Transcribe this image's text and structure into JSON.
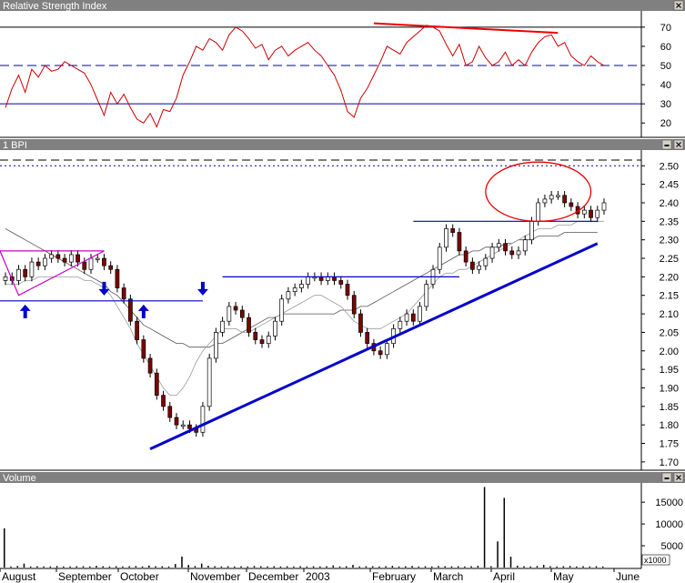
{
  "panels": {
    "rsi": {
      "title": "Relative Strength Index",
      "y_ticks": [
        "70",
        "60",
        "50",
        "40",
        "30",
        "20"
      ]
    },
    "price": {
      "title": "1 BPI",
      "y_ticks": [
        "2.50",
        "2.45",
        "2.40",
        "2.35",
        "2.30",
        "2.25",
        "2.20",
        "2.15",
        "2.10",
        "2.05",
        "2.00",
        "1.95",
        "1.90",
        "1.85",
        "1.80",
        "1.75",
        "1.70"
      ]
    },
    "volume": {
      "title": "Volume",
      "y_ticks": [
        "15000",
        "10000",
        "5000"
      ],
      "unit": "x1000"
    }
  },
  "x_axis": {
    "labels": [
      "August",
      "September",
      "October",
      "November",
      "December",
      "2003",
      "February",
      "March",
      "April",
      "May",
      "June"
    ]
  },
  "colors": {
    "rsi_line": "#cc0000",
    "up_candle": "#ffffff",
    "down_candle": "#800000",
    "trendline": "#0000cc",
    "highlight": "#ee0000",
    "triangle": "#cc00cc"
  },
  "chart_data": [
    {
      "type": "line",
      "title": "Relative Strength Index",
      "ylim": [
        13,
        78
      ],
      "reference_lines": [
        70,
        50,
        30
      ],
      "series": [
        {
          "name": "Relative Strength Index",
          "values": [
            28,
            38,
            45,
            36,
            48,
            44,
            50,
            47,
            48,
            52,
            50,
            48,
            46,
            40,
            32,
            24,
            36,
            30,
            35,
            28,
            22,
            20,
            25,
            18,
            27,
            26,
            33,
            45,
            52,
            60,
            58,
            64,
            62,
            58,
            66,
            70,
            68,
            64,
            59,
            61,
            53,
            58,
            60,
            55,
            58,
            60,
            62,
            58,
            55,
            50,
            45,
            37,
            26,
            23,
            33,
            38,
            45,
            52,
            60,
            58,
            56,
            62,
            65,
            68,
            71,
            70,
            68,
            61,
            55,
            61,
            50,
            52,
            60,
            54,
            50,
            52,
            57,
            50,
            53,
            50,
            57,
            62,
            65,
            66,
            60,
            62,
            55,
            52,
            50,
            55,
            52,
            50
          ]
        }
      ],
      "annotations": [
        {
          "type": "trendline",
          "from": [
            56,
            72
          ],
          "to": [
            84,
            67
          ]
        }
      ]
    },
    {
      "type": "line",
      "title": "1 BPI",
      "ylim": [
        1.68,
        2.54
      ],
      "reference_lines": [
        2.5,
        2.35,
        2.2,
        2.13
      ],
      "series": [
        {
          "name": "1 BPI",
          "values": [
            2.2,
            2.19,
            2.22,
            2.2,
            2.24,
            2.23,
            2.25,
            2.26,
            2.25,
            2.24,
            2.26,
            2.24,
            2.22,
            2.25,
            2.25,
            2.23,
            2.22,
            2.17,
            2.14,
            2.08,
            2.03,
            1.98,
            1.94,
            1.88,
            1.85,
            1.82,
            1.8,
            1.8,
            1.79,
            1.78,
            1.85,
            1.98,
            2.05,
            2.08,
            2.12,
            2.11,
            2.09,
            2.05,
            2.03,
            2.02,
            2.04,
            2.08,
            2.14,
            2.16,
            2.17,
            2.18,
            2.2,
            2.2,
            2.19,
            2.2,
            2.19,
            2.18,
            2.15,
            2.1,
            2.05,
            2.02,
            2.0,
            1.99,
            2.02,
            2.06,
            2.08,
            2.1,
            2.08,
            2.12,
            2.18,
            2.22,
            2.28,
            2.33,
            2.32,
            2.27,
            2.24,
            2.22,
            2.23,
            2.25,
            2.28,
            2.29,
            2.27,
            2.26,
            2.27,
            2.3,
            2.35,
            2.4,
            2.41,
            2.42,
            2.42,
            2.4,
            2.39,
            2.37,
            2.38,
            2.36,
            2.38,
            2.4
          ]
        },
        {
          "name": "moving average (fast)",
          "values": [
            2.18,
            2.18,
            2.18,
            2.19,
            2.19,
            2.2,
            2.2,
            2.2,
            2.2,
            2.2,
            2.2,
            2.2,
            2.19,
            2.19,
            2.18,
            2.17,
            2.15,
            2.12,
            2.09,
            2.06,
            2.02,
            1.99,
            1.96,
            1.93,
            1.9,
            1.88,
            1.88,
            1.9,
            1.93,
            1.97,
            2.0,
            2.02,
            2.04,
            2.06,
            2.06,
            2.06,
            2.05,
            2.05,
            2.06,
            2.07,
            2.08,
            2.09,
            2.1,
            2.11,
            2.12,
            2.13,
            2.14,
            2.15,
            2.15,
            2.14,
            2.13,
            2.12,
            2.1,
            2.08,
            2.07,
            2.06,
            2.06,
            2.06,
            2.07,
            2.08,
            2.09,
            2.1,
            2.12,
            2.14,
            2.16,
            2.18,
            2.2,
            2.21,
            2.21,
            2.22,
            2.22,
            2.23,
            2.24,
            2.25,
            2.26,
            2.27,
            2.28,
            2.29,
            2.3,
            2.31,
            2.32,
            2.33,
            2.33,
            2.33,
            2.34,
            2.34,
            2.34,
            2.35,
            2.35,
            2.35,
            2.35,
            2.35
          ]
        },
        {
          "name": "moving average (slow)",
          "values": [
            2.33,
            2.32,
            2.31,
            2.3,
            2.29,
            2.28,
            2.27,
            2.26,
            2.25,
            2.24,
            2.23,
            2.22,
            2.21,
            2.2,
            2.19,
            2.18,
            2.16,
            2.15,
            2.13,
            2.11,
            2.09,
            2.07,
            2.06,
            2.05,
            2.04,
            2.03,
            2.02,
            2.02,
            2.01,
            2.01,
            2.01,
            2.01,
            2.02,
            2.02,
            2.03,
            2.04,
            2.05,
            2.06,
            2.07,
            2.08,
            2.09,
            2.09,
            2.1,
            2.1,
            2.1,
            2.1,
            2.1,
            2.1,
            2.1,
            2.1,
            2.1,
            2.11,
            2.11,
            2.11,
            2.12,
            2.12,
            2.13,
            2.14,
            2.15,
            2.16,
            2.17,
            2.18,
            2.19,
            2.2,
            2.21,
            2.22,
            2.23,
            2.24,
            2.25,
            2.26,
            2.26,
            2.27,
            2.27,
            2.28,
            2.28,
            2.28,
            2.29,
            2.29,
            2.3,
            2.3,
            2.3,
            2.31,
            2.31,
            2.31,
            2.31,
            2.32,
            2.32,
            2.32,
            2.32,
            2.32,
            2.32
          ]
        }
      ],
      "annotations": [
        {
          "type": "trendline",
          "from": [
            22,
            1.735
          ],
          "to": [
            90,
            2.29
          ]
        },
        {
          "type": "line",
          "from": [
            0,
            2.135
          ],
          "to": [
            30,
            2.135
          ]
        },
        {
          "type": "line",
          "from": [
            33,
            2.2
          ],
          "to": [
            69,
            2.2
          ]
        },
        {
          "type": "line",
          "from": [
            62,
            2.35
          ],
          "to": [
            90,
            2.35
          ]
        },
        {
          "type": "triangle",
          "points": [
            [
              0,
              2.27
            ],
            [
              15,
              2.27
            ],
            [
              2,
              2.15
            ]
          ]
        },
        {
          "type": "circle",
          "center": [
            81,
            2.43
          ],
          "radius": [
            8,
            0.08
          ]
        },
        {
          "type": "arrow",
          "x": 3,
          "direction": "up"
        },
        {
          "type": "arrow",
          "x": 21,
          "direction": "up"
        },
        {
          "type": "arrow",
          "x": 15,
          "direction": "down"
        },
        {
          "type": "arrow",
          "x": 30,
          "direction": "down"
        }
      ]
    },
    {
      "type": "bar",
      "title": "Volume",
      "ylim": [
        0,
        19000
      ],
      "series": [
        {
          "name": "Volume",
          "values": [
            9000,
            250,
            350,
            900,
            250,
            300,
            250,
            250,
            350,
            250,
            250,
            300,
            300,
            250,
            400,
            300,
            250,
            300,
            250,
            300,
            350,
            250,
            450,
            300,
            300,
            250,
            800,
            2500,
            600,
            350,
            900,
            400,
            300,
            250,
            300,
            250,
            300,
            250,
            350,
            300,
            250,
            300,
            250,
            300,
            250,
            300,
            250,
            300,
            250,
            300,
            500,
            250,
            300,
            600,
            250,
            300,
            300,
            250,
            300,
            400,
            250,
            300,
            350,
            250,
            300,
            250,
            350,
            300,
            250,
            300,
            250,
            300,
            400,
            18500,
            300,
            6000,
            16000,
            2500,
            400,
            300,
            250,
            350,
            600,
            300,
            250,
            300,
            350,
            250,
            300,
            250,
            300,
            250
          ]
        }
      ]
    }
  ]
}
